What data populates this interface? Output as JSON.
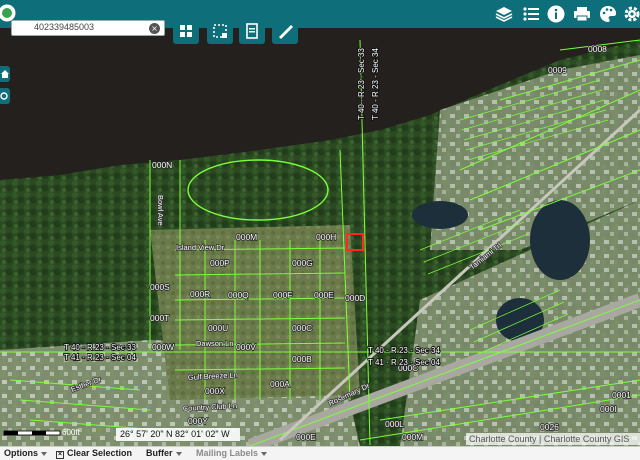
{
  "header": {
    "search_value": "402339485003",
    "icons": [
      "layers-icon",
      "legend-list-icon",
      "info-icon",
      "print-icon",
      "basemap-palette-icon",
      "settings-gear-icon"
    ],
    "tools": [
      "grid-icon",
      "selection-icon",
      "notes-icon",
      "measure-pen-icon"
    ]
  },
  "map": {
    "parcel_labels": [
      {
        "text": "0008"
      },
      {
        "text": "0009"
      },
      {
        "text": "000N"
      },
      {
        "text": "000M"
      },
      {
        "text": "000H"
      },
      {
        "text": "000P"
      },
      {
        "text": "000G"
      },
      {
        "text": "000S"
      },
      {
        "text": "000R"
      },
      {
        "text": "000Q"
      },
      {
        "text": "000F"
      },
      {
        "text": "000E"
      },
      {
        "text": "000D"
      },
      {
        "text": "000T"
      },
      {
        "text": "000U"
      },
      {
        "text": "000C"
      },
      {
        "text": "000W"
      },
      {
        "text": "000V"
      },
      {
        "text": "000B"
      },
      {
        "text": "000X"
      },
      {
        "text": "000A"
      },
      {
        "text": "000Y"
      },
      {
        "text": "000E"
      },
      {
        "text": "000M"
      },
      {
        "text": "000C"
      },
      {
        "text": "000L"
      },
      {
        "text": "0026"
      },
      {
        "text": "0001"
      },
      {
        "text": "000I"
      }
    ],
    "road_labels": [
      {
        "text": "Island View Dr"
      },
      {
        "text": "Dawson Ln"
      },
      {
        "text": "Gulf Breeze Ln"
      },
      {
        "text": "Country Club Ln"
      },
      {
        "text": "Rosemary Dr"
      },
      {
        "text": "Esther Dr"
      },
      {
        "text": "Bowl Ave"
      },
      {
        "text": "Tamiami Trl"
      }
    ],
    "survey_labels": [
      {
        "text": "T 40 - R 23 - Sec 33"
      },
      {
        "text": "T 40 - R 23 - Sec 34"
      },
      {
        "text": "T 40 - R 23 - Sec 33"
      },
      {
        "text": "T 41 - R 23 - Sec 04"
      },
      {
        "text": "T 40 - R 23 - Sec 34"
      },
      {
        "text": "T 41 - R 23 - Sec 04"
      }
    ],
    "selected_parcel_color": "#ff2a1a",
    "parcel_line_color": "#7dff3a"
  },
  "scale": {
    "label": "600ft"
  },
  "coordinates": "26° 57' 20\" N 82° 01' 02\" W",
  "attribution": "Charlotte County | Charlotte County GIS",
  "statusbar": {
    "options": "Options",
    "clear_selection": "Clear Selection",
    "buffer": "Buffer",
    "mailing_labels": "Mailing Labels"
  },
  "colors": {
    "header_bg": "#0e6e7a",
    "accent": "#0e6e7a"
  }
}
